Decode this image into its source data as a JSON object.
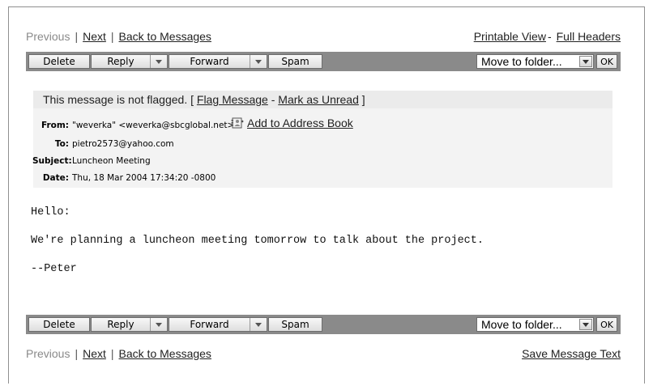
{
  "nav_top": {
    "previous": "Previous",
    "next": "Next",
    "back": "Back to Messages",
    "printable": "Printable View",
    "dash": "-",
    "full_headers": "Full Headers"
  },
  "toolbar": {
    "delete": "Delete",
    "reply": "Reply",
    "forward": "Forward",
    "spam": "Spam",
    "move_folder": "Move to folder...",
    "ok": "OK"
  },
  "flag": {
    "prefix": "This message is not flagged. [",
    "flag_link": "Flag Message",
    "sep": "-",
    "unread_link": "Mark as Unread",
    "suffix": "]"
  },
  "headers": {
    "from_label": "From:",
    "from_value": "\"weverka\" <weverka@sbcglobal.net>",
    "add_book": "Add to Address Book",
    "to_label": "To:",
    "to_value": "pietro2573@yahoo.com",
    "subject_label": "Subject:",
    "subject_value": "Luncheon Meeting",
    "date_label": "Date:",
    "date_value": "Thu, 18 Mar 2004 17:34:20 -0800"
  },
  "body": {
    "line1": "Hello:",
    "line2": "We're planning a luncheon meeting tomorrow to talk about the project.",
    "line3": "--Peter"
  },
  "nav_bottom": {
    "previous": "Previous",
    "next": "Next",
    "back": "Back to Messages",
    "save": "Save Message Text"
  },
  "colors": {
    "toolbar_bg": "#8a8a8a",
    "flag_bg": "#ebebeb",
    "header_bg": "#f3f3f3"
  }
}
